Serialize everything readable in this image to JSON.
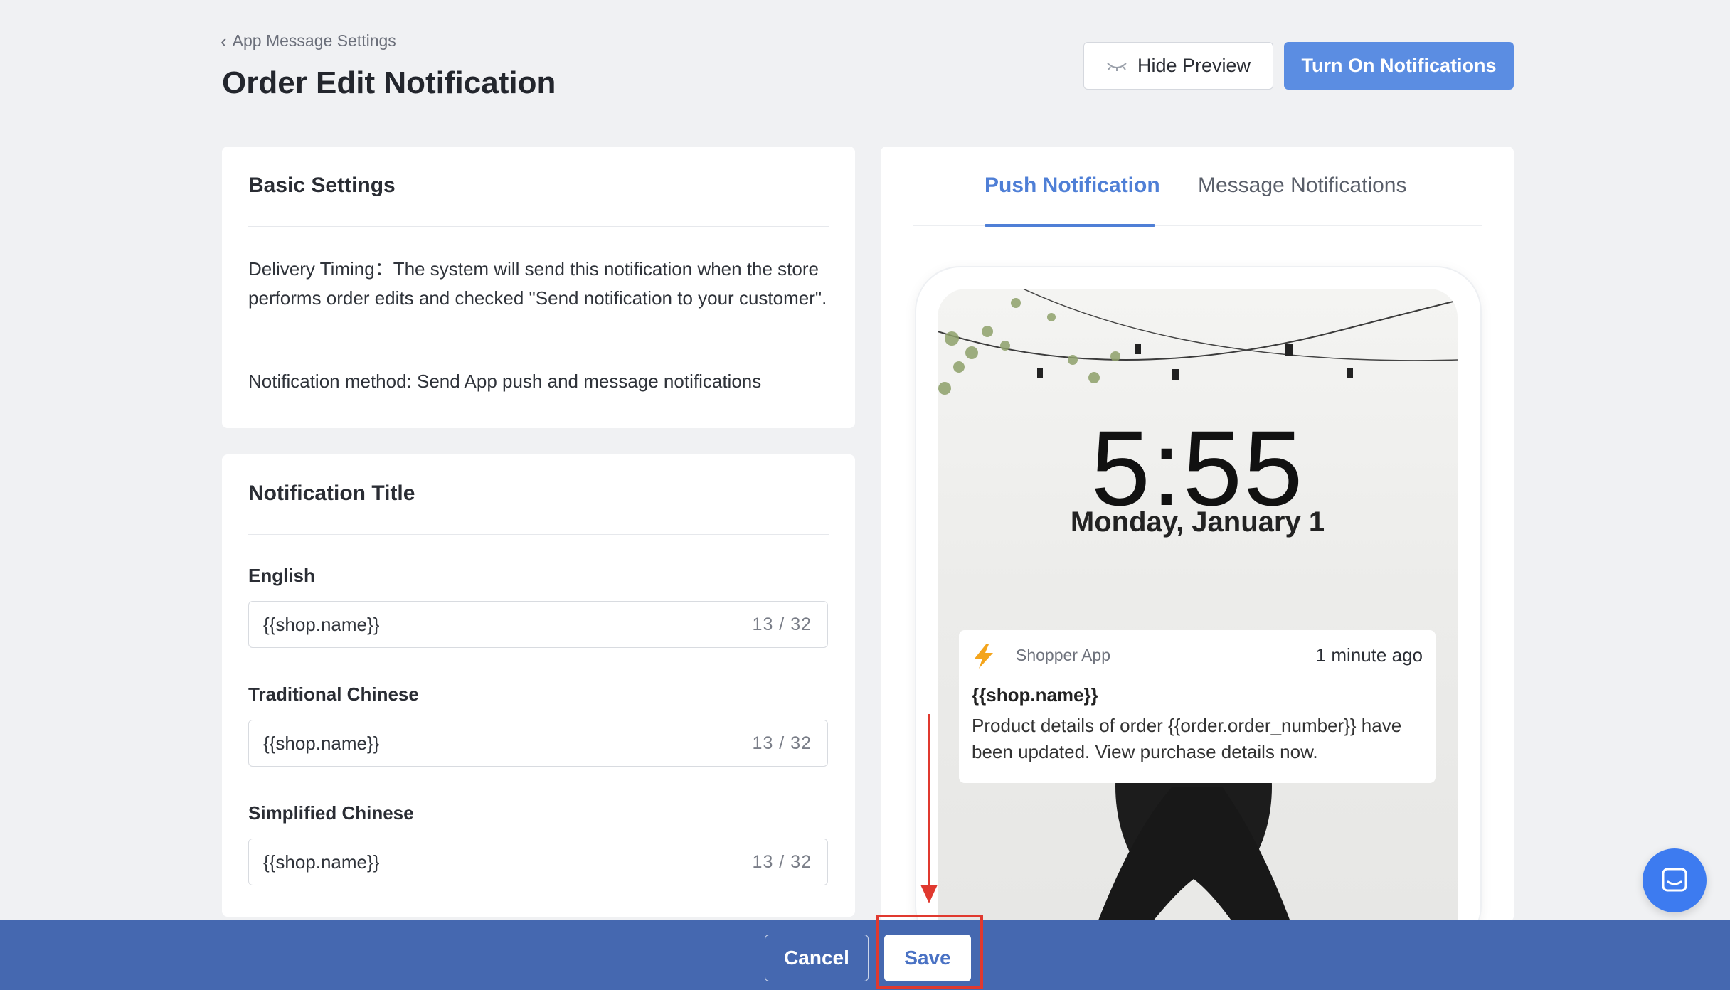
{
  "header": {
    "breadcrumb": "App Message Settings",
    "title": "Order Edit Notification",
    "hide_preview_label": "Hide Preview",
    "turn_on_label": "Turn On Notifications"
  },
  "basic_settings": {
    "title": "Basic Settings",
    "delivery_timing": "Delivery Timing：The system will send this notification when the store performs order edits and checked \"Send notification to your customer\".",
    "notification_method": "Notification method: Send App push and message notifications"
  },
  "notification_title": {
    "title": "Notification Title",
    "fields": [
      {
        "label": "English",
        "value": "{{shop.name}}",
        "count": "13 / 32"
      },
      {
        "label": "Traditional Chinese",
        "value": "{{shop.name}}",
        "count": "13 / 32"
      },
      {
        "label": "Simplified Chinese",
        "value": "{{shop.name}}",
        "count": "13 / 32"
      }
    ]
  },
  "preview": {
    "tabs": [
      {
        "label": "Push Notification",
        "active": true
      },
      {
        "label": "Message Notifications",
        "active": false
      }
    ],
    "lock_time": "5:55",
    "lock_date": "Monday, January 1",
    "notification": {
      "app_name": "Shopper App",
      "time_ago": "1 minute ago",
      "title": "{{shop.name}}",
      "body": "Product details of order {{order.order_number}} have been updated. View purchase details now."
    }
  },
  "footer": {
    "cancel_label": "Cancel",
    "save_label": "Save"
  },
  "colors": {
    "primary": "#5b8de2",
    "footer_bar": "#4568b0",
    "tab_active": "#4f7fd6",
    "annotation_red": "#e0392f"
  },
  "icons": [
    "chevron-left-icon",
    "eye-closed-icon",
    "lightning-bolt-icon",
    "chat-icon"
  ]
}
